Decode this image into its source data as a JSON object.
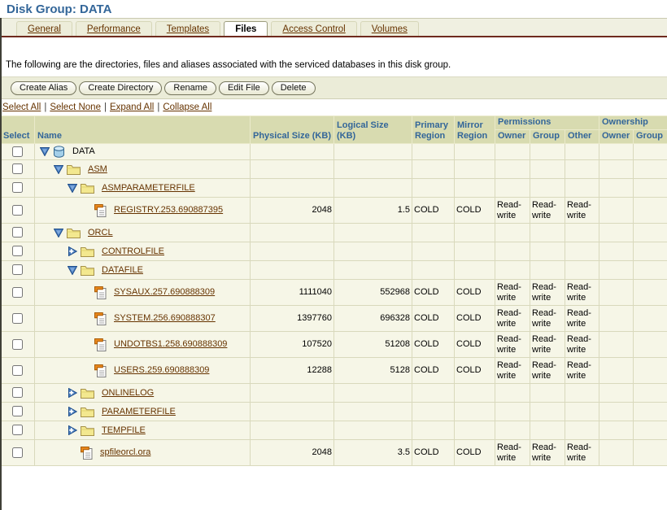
{
  "page": {
    "title": "Disk Group: DATA",
    "description": "The following are the directories, files and aliases associated with the serviced databases in this disk group."
  },
  "colors": {
    "title_blue": "#336699",
    "link_maroon": "#663300",
    "tab_line": "#6f2a1e",
    "header_bg": "#d8dbb0",
    "row_bg": "#f6f6e7",
    "toolbar_bg": "#ebecd8"
  },
  "tabs": [
    {
      "label": "General",
      "active": false
    },
    {
      "label": "Performance",
      "active": false
    },
    {
      "label": "Templates",
      "active": false
    },
    {
      "label": "Files",
      "active": true
    },
    {
      "label": "Access Control",
      "active": false
    },
    {
      "label": "Volumes",
      "active": false
    }
  ],
  "toolbar": {
    "buttons": [
      "Create Alias",
      "Create Directory",
      "Rename",
      "Edit File",
      "Delete"
    ]
  },
  "selection_links": [
    "Select All",
    "Select None",
    "Expand All",
    "Collapse All"
  ],
  "table": {
    "headers": {
      "select": "Select",
      "name": "Name",
      "physical": "Physical Size (KB)",
      "logical": "Logical Size (KB)",
      "primary": "Primary Region",
      "mirror": "Mirror Region",
      "permissions": "Permissions",
      "ownership": "Ownership",
      "perm_owner": "Owner",
      "perm_group": "Group",
      "perm_other": "Other",
      "own_owner": "Owner",
      "own_group": "Group"
    },
    "rows": [
      {
        "name": "DATA",
        "level": 0,
        "icon": "disk-group-icon",
        "twisty": "expanded",
        "link": false,
        "physical": "",
        "logical": "",
        "primary": "",
        "mirror": "",
        "perm_owner": "",
        "perm_group": "",
        "perm_other": "",
        "own_owner": "",
        "own_group": ""
      },
      {
        "name": "ASM",
        "level": 1,
        "icon": "folder-icon",
        "twisty": "expanded",
        "link": true,
        "physical": "",
        "logical": "",
        "primary": "",
        "mirror": "",
        "perm_owner": "",
        "perm_group": "",
        "perm_other": "",
        "own_owner": "",
        "own_group": ""
      },
      {
        "name": "ASMPARAMETERFILE",
        "level": 2,
        "icon": "folder-icon",
        "twisty": "expanded",
        "link": true,
        "physical": "",
        "logical": "",
        "primary": "",
        "mirror": "",
        "perm_owner": "",
        "perm_group": "",
        "perm_other": "",
        "own_owner": "",
        "own_group": ""
      },
      {
        "name": "REGISTRY.253.690887395",
        "level": 3,
        "icon": "file-icon",
        "twisty": "",
        "link": true,
        "physical": "2048",
        "logical": "1.5",
        "primary": "COLD",
        "mirror": "COLD",
        "perm_owner": "Read-write",
        "perm_group": "Read-write",
        "perm_other": "Read-write",
        "own_owner": "",
        "own_group": ""
      },
      {
        "name": "ORCL",
        "level": 1,
        "icon": "folder-icon",
        "twisty": "expanded",
        "link": true,
        "physical": "",
        "logical": "",
        "primary": "",
        "mirror": "",
        "perm_owner": "",
        "perm_group": "",
        "perm_other": "",
        "own_owner": "",
        "own_group": ""
      },
      {
        "name": "CONTROLFILE",
        "level": 2,
        "icon": "folder-icon",
        "twisty": "collapsed",
        "link": true,
        "physical": "",
        "logical": "",
        "primary": "",
        "mirror": "",
        "perm_owner": "",
        "perm_group": "",
        "perm_other": "",
        "own_owner": "",
        "own_group": ""
      },
      {
        "name": "DATAFILE",
        "level": 2,
        "icon": "folder-icon",
        "twisty": "expanded",
        "link": true,
        "physical": "",
        "logical": "",
        "primary": "",
        "mirror": "",
        "perm_owner": "",
        "perm_group": "",
        "perm_other": "",
        "own_owner": "",
        "own_group": ""
      },
      {
        "name": "SYSAUX.257.690888309",
        "level": 3,
        "icon": "file-icon",
        "twisty": "",
        "link": true,
        "physical": "1111040",
        "logical": "552968",
        "primary": "COLD",
        "mirror": "COLD",
        "perm_owner": "Read-write",
        "perm_group": "Read-write",
        "perm_other": "Read-write",
        "own_owner": "",
        "own_group": ""
      },
      {
        "name": "SYSTEM.256.690888307",
        "level": 3,
        "icon": "file-icon",
        "twisty": "",
        "link": true,
        "physical": "1397760",
        "logical": "696328",
        "primary": "COLD",
        "mirror": "COLD",
        "perm_owner": "Read-write",
        "perm_group": "Read-write",
        "perm_other": "Read-write",
        "own_owner": "",
        "own_group": ""
      },
      {
        "name": "UNDOTBS1.258.690888309",
        "level": 3,
        "icon": "file-icon",
        "twisty": "",
        "link": true,
        "physical": "107520",
        "logical": "51208",
        "primary": "COLD",
        "mirror": "COLD",
        "perm_owner": "Read-write",
        "perm_group": "Read-write",
        "perm_other": "Read-write",
        "own_owner": "",
        "own_group": ""
      },
      {
        "name": "USERS.259.690888309",
        "level": 3,
        "icon": "file-icon",
        "twisty": "",
        "link": true,
        "physical": "12288",
        "logical": "5128",
        "primary": "COLD",
        "mirror": "COLD",
        "perm_owner": "Read-write",
        "perm_group": "Read-write",
        "perm_other": "Read-write",
        "own_owner": "",
        "own_group": ""
      },
      {
        "name": "ONLINELOG",
        "level": 2,
        "icon": "folder-icon",
        "twisty": "collapsed",
        "link": true,
        "physical": "",
        "logical": "",
        "primary": "",
        "mirror": "",
        "perm_owner": "",
        "perm_group": "",
        "perm_other": "",
        "own_owner": "",
        "own_group": ""
      },
      {
        "name": "PARAMETERFILE",
        "level": 2,
        "icon": "folder-icon",
        "twisty": "collapsed",
        "link": true,
        "physical": "",
        "logical": "",
        "primary": "",
        "mirror": "",
        "perm_owner": "",
        "perm_group": "",
        "perm_other": "",
        "own_owner": "",
        "own_group": ""
      },
      {
        "name": "TEMPFILE",
        "level": 2,
        "icon": "folder-icon",
        "twisty": "collapsed",
        "link": true,
        "physical": "",
        "logical": "",
        "primary": "",
        "mirror": "",
        "perm_owner": "",
        "perm_group": "",
        "perm_other": "",
        "own_owner": "",
        "own_group": ""
      },
      {
        "name": "spfileorcl.ora",
        "level": 2,
        "icon": "file-icon",
        "twisty": "",
        "link": true,
        "physical": "2048",
        "logical": "3.5",
        "primary": "COLD",
        "mirror": "COLD",
        "perm_owner": "Read-write",
        "perm_group": "Read-write",
        "perm_other": "Read-write",
        "own_owner": "",
        "own_group": ""
      }
    ]
  }
}
